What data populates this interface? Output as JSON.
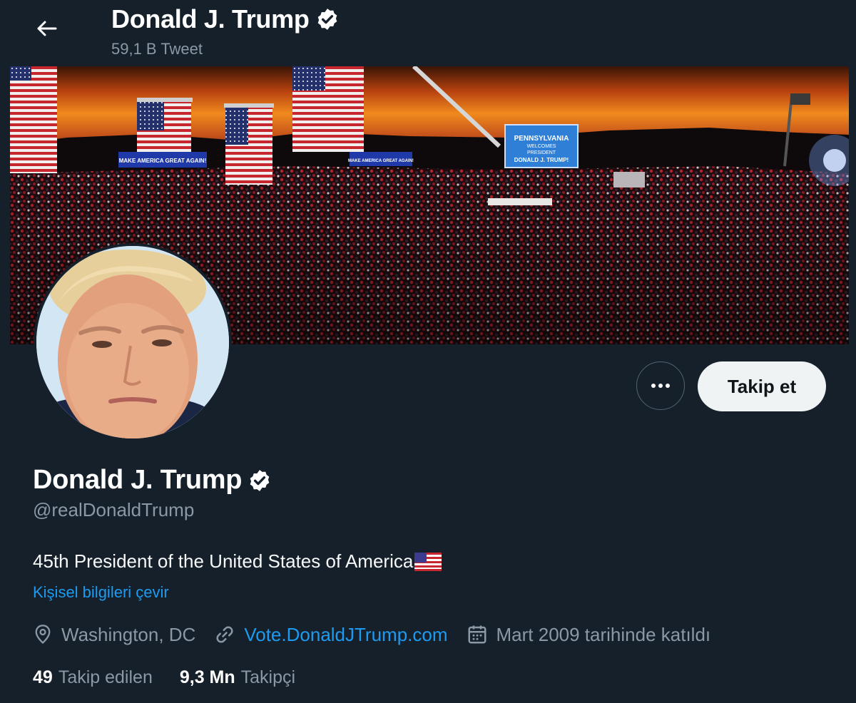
{
  "header": {
    "title": "Donald J. Trump",
    "tweet_count": "59,1 B Tweet"
  },
  "banner": {
    "sign_left": "MAKE AMERICA GREAT AGAIN!",
    "sign_center": "MAKE AMERICA GREAT AGAIN!",
    "screen_line1": "PENNSYLVANIA",
    "screen_line2": "WELCOMES",
    "screen_line3": "PRESIDENT",
    "screen_line4": "DONALD J. TRUMP!"
  },
  "actions": {
    "follow_label": "Takip et"
  },
  "profile": {
    "name": "Donald J. Trump",
    "handle": "@realDonaldTrump",
    "bio": "45th President of the United States of America",
    "translate_label": "Kişisel bilgileri çevir",
    "location": "Washington, DC",
    "website": "Vote.DonaldJTrump.com",
    "joined": "Mart 2009 tarihinde katıldı"
  },
  "stats": {
    "following_count": "49",
    "following_label": "Takip edilen",
    "followers_count": "9,3 Mn",
    "followers_label": "Takipçi"
  },
  "colors": {
    "background": "#15202b",
    "accent": "#1d9bf0",
    "secondary_text": "#8b98a5",
    "follow_button_bg": "#eff3f4"
  },
  "icons": [
    "back-arrow-icon",
    "verified-badge-icon",
    "more-icon",
    "location-icon",
    "link-icon",
    "calendar-icon",
    "us-flag-icon"
  ]
}
